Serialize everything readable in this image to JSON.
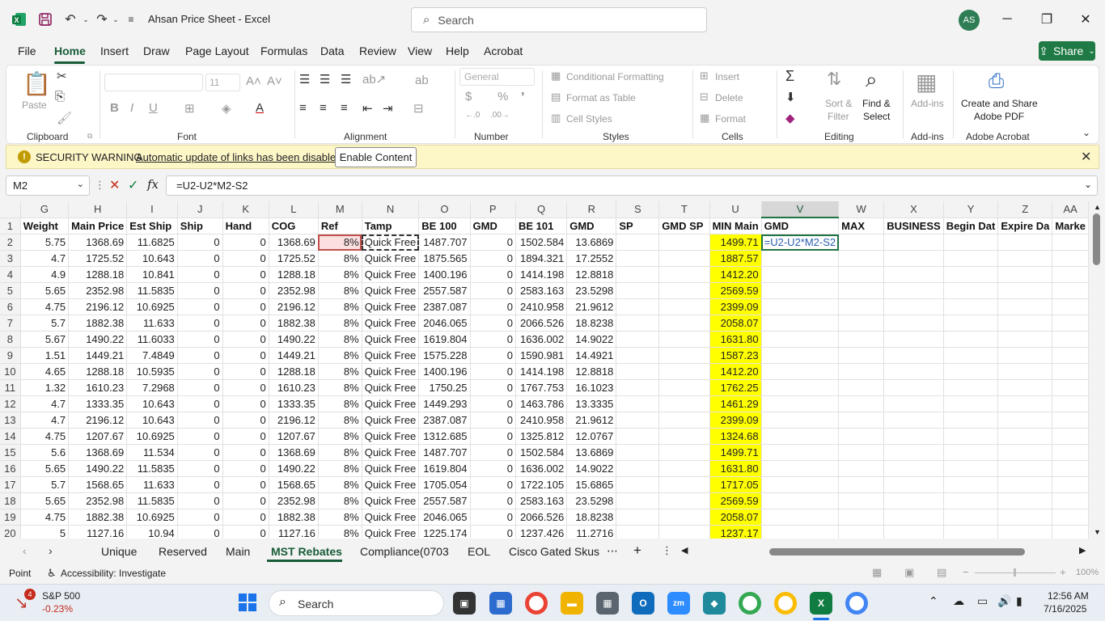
{
  "titlebar": {
    "app_title": "Ahsan Price Sheet  -  Excel",
    "search_placeholder": "Search",
    "avatar": "AS",
    "icons": [
      "excel-logo-icon",
      "save-icon",
      "undo-icon",
      "redo-icon",
      "customize-icon",
      "search-icon",
      "minimize-icon",
      "restore-icon",
      "close-icon"
    ]
  },
  "menu": {
    "tabs": [
      "File",
      "Home",
      "Insert",
      "Draw",
      "Page Layout",
      "Formulas",
      "Data",
      "Review",
      "View",
      "Help",
      "Acrobat"
    ],
    "active": "Home",
    "share": "Share"
  },
  "ribbon": {
    "groups": [
      "Clipboard",
      "Font",
      "Alignment",
      "Number",
      "Styles",
      "Cells",
      "Editing",
      "Add-ins",
      "Adobe Acrobat"
    ],
    "paste": "Paste",
    "font_size": "11",
    "number_format": "General",
    "conditional_formatting": "Conditional Formatting",
    "format_as_table": "Format as Table",
    "cell_styles": "Cell Styles",
    "insert": "Insert",
    "delete": "Delete",
    "format": "Format",
    "sort_filter_1": "Sort &",
    "sort_filter_2": "Filter",
    "find_select_1": "Find &",
    "find_select_2": "Select",
    "addins": "Add-ins",
    "acrobat_1": "Create and Share",
    "acrobat_2": "Adobe PDF"
  },
  "security": {
    "title": "SECURITY WARNING",
    "message": "Automatic update of links has been disabled",
    "button": "Enable Content"
  },
  "formula_bar": {
    "name_box": "M2",
    "formula": "=U2-U2*M2-S2",
    "fx": "fx"
  },
  "grid": {
    "columns": [
      "G",
      "H",
      "I",
      "J",
      "K",
      "L",
      "M",
      "N",
      "O",
      "P",
      "Q",
      "R",
      "S",
      "T",
      "U",
      "V",
      "W",
      "X",
      "Y",
      "Z",
      "AA"
    ],
    "headers": [
      "Weight",
      "Main Price",
      "Est Ship",
      "Ship",
      "Hand",
      "COG",
      "Ref",
      "Tamp",
      "BE 100",
      "GMD",
      "BE 101",
      "GMD",
      "SP",
      "GMD SP",
      "MIN Main",
      "GMD",
      "MAX",
      "BUSINESS",
      "Begin Dat",
      "Expire Da",
      "Marke"
    ],
    "edit_cell": "=U2-U2*M2-S2",
    "rows": [
      [
        "5.75",
        "1368.69",
        "11.6825",
        "0",
        "0",
        "1368.69",
        "8%",
        "Quick Free",
        "1487.707",
        "0",
        "1502.584",
        "13.6869",
        "",
        "",
        "1499.71"
      ],
      [
        "4.7",
        "1725.52",
        "10.643",
        "0",
        "0",
        "1725.52",
        "8%",
        "Quick Free",
        "1875.565",
        "0",
        "1894.321",
        "17.2552",
        "",
        "",
        "1887.57"
      ],
      [
        "4.9",
        "1288.18",
        "10.841",
        "0",
        "0",
        "1288.18",
        "8%",
        "Quick Free",
        "1400.196",
        "0",
        "1414.198",
        "12.8818",
        "",
        "",
        "1412.20"
      ],
      [
        "5.65",
        "2352.98",
        "11.5835",
        "0",
        "0",
        "2352.98",
        "8%",
        "Quick Free",
        "2557.587",
        "0",
        "2583.163",
        "23.5298",
        "",
        "",
        "2569.59"
      ],
      [
        "4.75",
        "2196.12",
        "10.6925",
        "0",
        "0",
        "2196.12",
        "8%",
        "Quick Free",
        "2387.087",
        "0",
        "2410.958",
        "21.9612",
        "",
        "",
        "2399.09"
      ],
      [
        "5.7",
        "1882.38",
        "11.633",
        "0",
        "0",
        "1882.38",
        "8%",
        "Quick Free",
        "2046.065",
        "0",
        "2066.526",
        "18.8238",
        "",
        "",
        "2058.07"
      ],
      [
        "5.67",
        "1490.22",
        "11.6033",
        "0",
        "0",
        "1490.22",
        "8%",
        "Quick Free",
        "1619.804",
        "0",
        "1636.002",
        "14.9022",
        "",
        "",
        "1631.80"
      ],
      [
        "1.51",
        "1449.21",
        "7.4849",
        "0",
        "0",
        "1449.21",
        "8%",
        "Quick Free",
        "1575.228",
        "0",
        "1590.981",
        "14.4921",
        "",
        "",
        "1587.23"
      ],
      [
        "4.65",
        "1288.18",
        "10.5935",
        "0",
        "0",
        "1288.18",
        "8%",
        "Quick Free",
        "1400.196",
        "0",
        "1414.198",
        "12.8818",
        "",
        "",
        "1412.20"
      ],
      [
        "1.32",
        "1610.23",
        "7.2968",
        "0",
        "0",
        "1610.23",
        "8%",
        "Quick Free",
        "1750.25",
        "0",
        "1767.753",
        "16.1023",
        "",
        "",
        "1762.25"
      ],
      [
        "4.7",
        "1333.35",
        "10.643",
        "0",
        "0",
        "1333.35",
        "8%",
        "Quick Free",
        "1449.293",
        "0",
        "1463.786",
        "13.3335",
        "",
        "",
        "1461.29"
      ],
      [
        "4.7",
        "2196.12",
        "10.643",
        "0",
        "0",
        "2196.12",
        "8%",
        "Quick Free",
        "2387.087",
        "0",
        "2410.958",
        "21.9612",
        "",
        "",
        "2399.09"
      ],
      [
        "4.75",
        "1207.67",
        "10.6925",
        "0",
        "0",
        "1207.67",
        "8%",
        "Quick Free",
        "1312.685",
        "0",
        "1325.812",
        "12.0767",
        "",
        "",
        "1324.68"
      ],
      [
        "5.6",
        "1368.69",
        "11.534",
        "0",
        "0",
        "1368.69",
        "8%",
        "Quick Free",
        "1487.707",
        "0",
        "1502.584",
        "13.6869",
        "",
        "",
        "1499.71"
      ],
      [
        "5.65",
        "1490.22",
        "11.5835",
        "0",
        "0",
        "1490.22",
        "8%",
        "Quick Free",
        "1619.804",
        "0",
        "1636.002",
        "14.9022",
        "",
        "",
        "1631.80"
      ],
      [
        "5.7",
        "1568.65",
        "11.633",
        "0",
        "0",
        "1568.65",
        "8%",
        "Quick Free",
        "1705.054",
        "0",
        "1722.105",
        "15.6865",
        "",
        "",
        "1717.05"
      ],
      [
        "5.65",
        "2352.98",
        "11.5835",
        "0",
        "0",
        "2352.98",
        "8%",
        "Quick Free",
        "2557.587",
        "0",
        "2583.163",
        "23.5298",
        "",
        "",
        "2569.59"
      ],
      [
        "4.75",
        "1882.38",
        "10.6925",
        "0",
        "0",
        "1882.38",
        "8%",
        "Quick Free",
        "2046.065",
        "0",
        "2066.526",
        "18.8238",
        "",
        "",
        "2058.07"
      ],
      [
        "5",
        "1127.16",
        "10.94",
        "0",
        "0",
        "1127.16",
        "8%",
        "Quick Free",
        "1225.174",
        "0",
        "1237.426",
        "11.2716",
        "",
        "",
        "1237.17"
      ]
    ]
  },
  "sheets": {
    "tabs": [
      "Unique",
      "Reserved",
      "Main",
      "MST Rebates",
      "Compliance(0703",
      "EOL",
      "Cisco Gated Skus"
    ],
    "active": "MST Rebates"
  },
  "status": {
    "mode": "Point",
    "accessibility": "Accessibility: Investigate",
    "zoom": "100%"
  },
  "taskbar": {
    "stock_name": "S&P 500",
    "stock_change": "-0.23%",
    "badge": "4",
    "search": "Search",
    "time": "12:56 AM",
    "date": "7/16/2025"
  }
}
